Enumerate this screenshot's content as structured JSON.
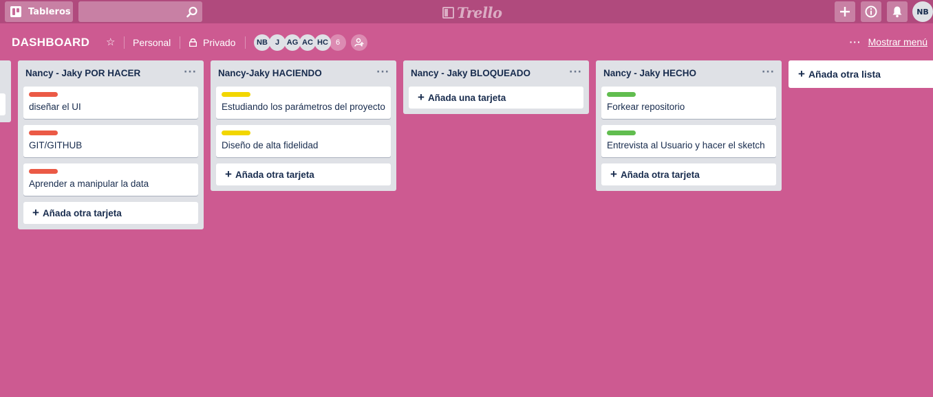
{
  "header": {
    "boards_label": "Tableros",
    "search_placeholder": "",
    "logo_text": "Trello",
    "user_initials": "NB"
  },
  "board": {
    "title": "DASHBOARD",
    "team": "Personal",
    "visibility": "Privado",
    "members": [
      "NB",
      "J",
      "AG",
      "AC",
      "HC"
    ],
    "member_overflow": "6",
    "menu_label": "Mostrar menú"
  },
  "colors": {
    "background": "#cd5a91",
    "label_red": "#eb5a46",
    "label_yellow": "#f2d600",
    "label_green": "#61bd4f"
  },
  "lists": [
    {
      "title": "Nancy - Jaky POR HACER",
      "cards": [
        {
          "title": "diseñar el UI",
          "label": "red"
        },
        {
          "title": "GIT/GITHUB",
          "label": "red"
        },
        {
          "title": "Aprender a manipular la data",
          "label": "red"
        }
      ],
      "add_label": "Añada otra tarjeta"
    },
    {
      "title": "Nancy-Jaky HACIENDO",
      "cards": [
        {
          "title": "Estudiando los parámetros del proyecto",
          "label": "yellow"
        },
        {
          "title": "Diseño de alta fidelidad",
          "label": "yellow"
        }
      ],
      "add_label": "Añada otra tarjeta"
    },
    {
      "title": "Nancy - Jaky BLOQUEADO",
      "cards": [],
      "add_label": "Añada una tarjeta"
    },
    {
      "title": "Nancy - Jaky HECHO",
      "cards": [
        {
          "title": "Forkear repositorio",
          "label": "green"
        },
        {
          "title": "Entrevista al Usuario y hacer el sketch",
          "label": "green"
        }
      ],
      "add_label": "Añada otra tarjeta"
    }
  ],
  "add_list_label": "Añada otra lista"
}
